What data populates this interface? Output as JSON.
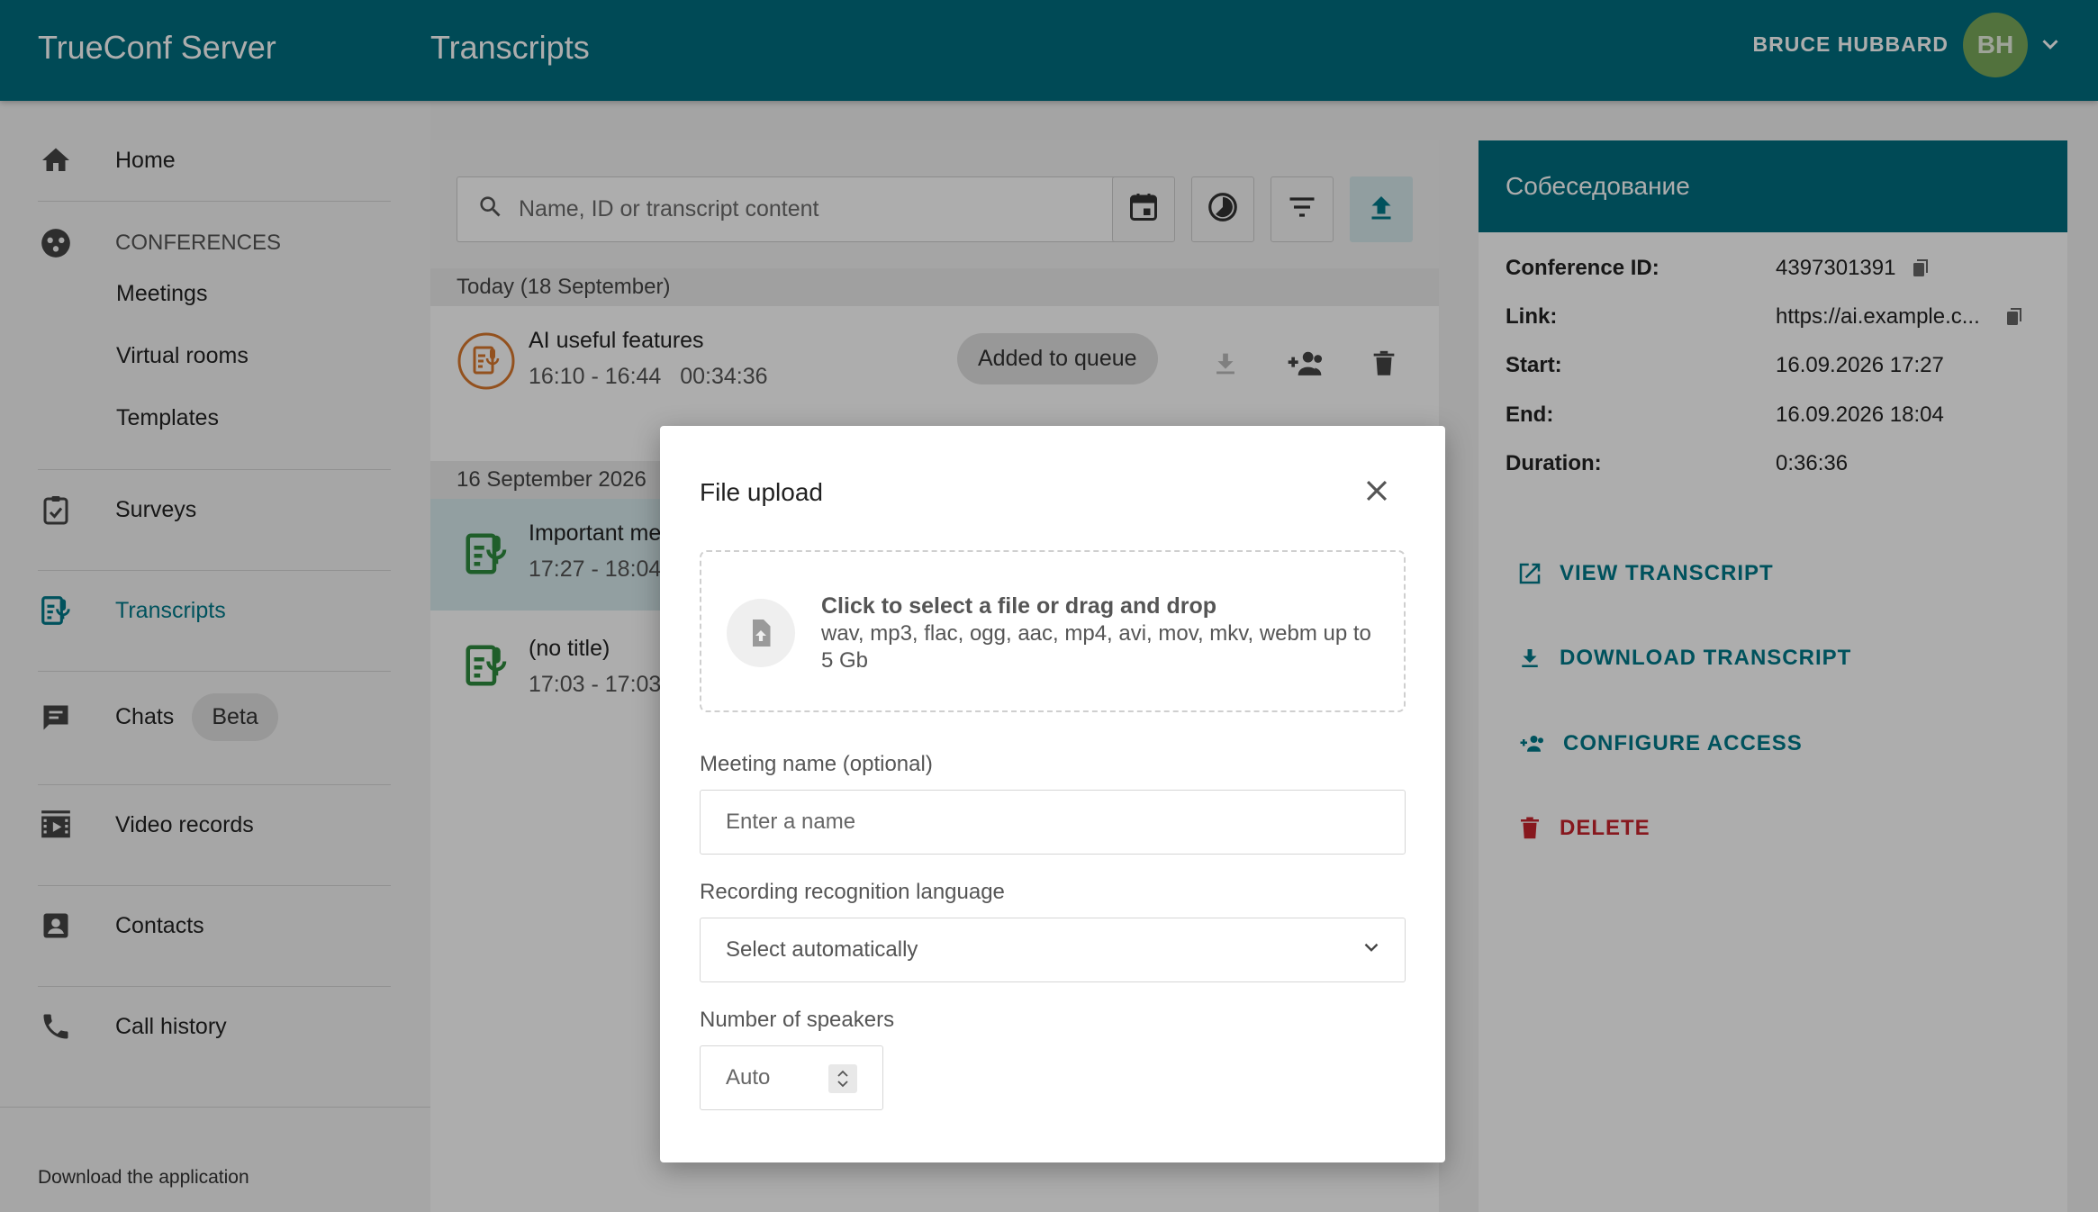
{
  "header": {
    "brand": "TrueConf Server",
    "title": "Transcripts",
    "user_name": "BRUCE HUBBARD",
    "avatar_initials": "BH"
  },
  "sidebar": {
    "home": "Home",
    "conferences": "CONFERENCES",
    "meetings": "Meetings",
    "virtual_rooms": "Virtual rooms",
    "templates": "Templates",
    "surveys": "Surveys",
    "transcripts": "Transcripts",
    "chats": "Chats",
    "chats_badge": "Beta",
    "video_records": "Video records",
    "contacts": "Contacts",
    "call_history": "Call history",
    "download_app": "Download the application"
  },
  "center": {
    "search_placeholder": "Name, ID or transcript content",
    "groups": [
      {
        "date": "Today (18 September)"
      },
      {
        "date": "16 September 2026"
      }
    ],
    "items": [
      {
        "title": "AI useful features",
        "time": "16:10 - 16:44",
        "duration": "00:34:36",
        "status": "Added to queue"
      },
      {
        "title": "Important me",
        "time": "17:27 - 18:04"
      },
      {
        "title": "(no title)",
        "time": "17:03 - 17:03"
      }
    ]
  },
  "details": {
    "title": "Собеседование",
    "conference_id_label": "Conference ID:",
    "conference_id": "4397301391",
    "link_label": "Link:",
    "link": "https://ai.example.c...",
    "start_label": "Start:",
    "start": "16.09.2026 17:27",
    "end_label": "End:",
    "end": "16.09.2026 18:04",
    "duration_label": "Duration:",
    "duration": "0:36:36",
    "view": "VIEW TRANSCRIPT",
    "download": "DOWNLOAD TRANSCRIPT",
    "access": "CONFIGURE ACCESS",
    "delete": "DELETE"
  },
  "modal": {
    "title": "File upload",
    "dropzone_title": "Click to select a file or drag and drop",
    "dropzone_sub": "wav, mp3, flac, ogg, aac, mp4, avi, mov, mkv, webm up to 5 Gb",
    "name_label": "Meeting name (optional)",
    "name_placeholder": "Enter a name",
    "language_label": "Recording recognition language",
    "language_value": "Select automatically",
    "speakers_label": "Number of speakers",
    "speakers_value": "Auto"
  },
  "colors": {
    "primary": "#006e7f",
    "accent": "#00798a",
    "danger": "#c8242d",
    "queue_orange": "#d9782d",
    "done_green": "#2e8b3e"
  }
}
